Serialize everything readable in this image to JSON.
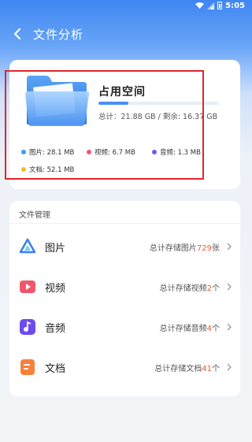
{
  "status_bar": {
    "time": "5:05"
  },
  "header": {
    "title": "文件分析"
  },
  "storage": {
    "title": "占用空间",
    "detail": "总计：21.88 GB / 剩余: 16.37 GB",
    "used_fraction": 0.25,
    "legend": [
      {
        "label": "图片: 28.1 MB",
        "color": "#3b9df0"
      },
      {
        "label": "视频: 6.7 MB",
        "color": "#f0566e"
      },
      {
        "label": "音频: 1.3 MB",
        "color": "#6b5cf0"
      },
      {
        "label": "文档: 52.1 MB",
        "color": "#f7b731"
      }
    ]
  },
  "manage": {
    "title": "文件管理",
    "rows": [
      {
        "label": "图片",
        "desc_prefix": "总计存储图片",
        "count": "729",
        "desc_suffix": "张",
        "icon": "image-icon"
      },
      {
        "label": "视频",
        "desc_prefix": "总计存储视频",
        "count": "2",
        "desc_suffix": "个",
        "icon": "video-icon"
      },
      {
        "label": "音频",
        "desc_prefix": "总计存储音频",
        "count": "4",
        "desc_suffix": "个",
        "icon": "audio-icon"
      },
      {
        "label": "文档",
        "desc_prefix": "总计存储文档",
        "count": "41",
        "desc_suffix": "个",
        "icon": "document-icon"
      }
    ]
  },
  "colors": {
    "accent": "#4a90f0",
    "highlight": "#e0262b",
    "count": "#e9573f"
  }
}
